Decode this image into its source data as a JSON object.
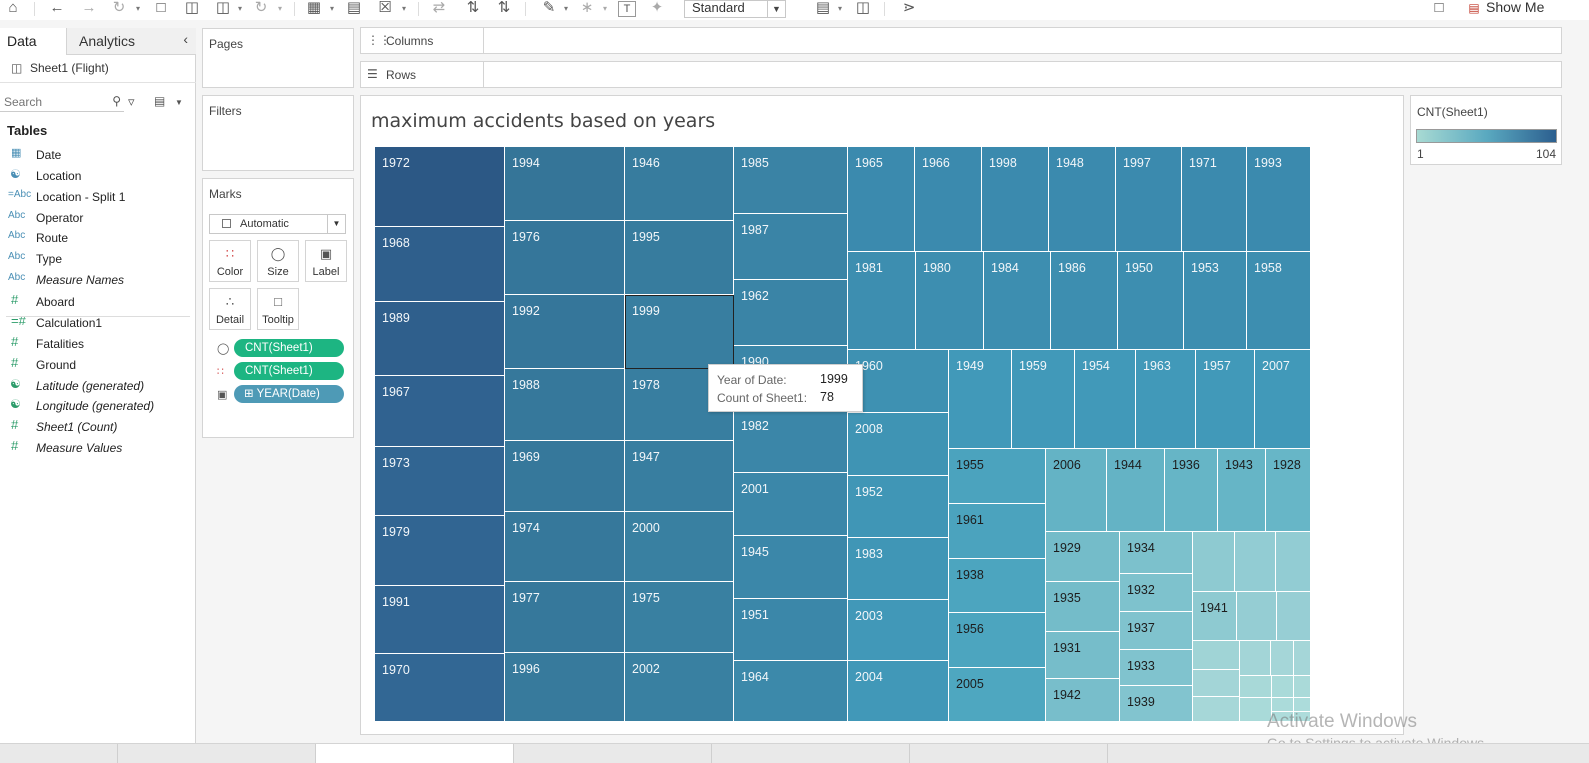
{
  "toolbar": {
    "fit_select": "Standard",
    "show_me": "Show Me"
  },
  "data_pane": {
    "tabs": {
      "data": "Data",
      "analytics": "Analytics"
    },
    "datasource": "Sheet1 (Flight)",
    "search_placeholder": "Search",
    "tables_heading": "Tables",
    "fields": [
      {
        "type": "date",
        "icon": "calendar-icon",
        "name": "Date"
      },
      {
        "type": "geo-dim",
        "icon": "globe-icon",
        "name": "Location"
      },
      {
        "type": "calc-dim",
        "icon": "abc-icon",
        "name": "Location - Split 1"
      },
      {
        "type": "dim",
        "icon": "abc-icon",
        "name": "Operator"
      },
      {
        "type": "dim",
        "icon": "abc-icon",
        "name": "Route"
      },
      {
        "type": "dim",
        "icon": "abc-icon",
        "name": "Type"
      },
      {
        "type": "dim-italic",
        "icon": "abc-icon",
        "name": "Measure Names"
      },
      {
        "type": "measure",
        "icon": "hash-icon",
        "name": "Aboard"
      },
      {
        "type": "calc-measure",
        "icon": "hash-icon",
        "name": "Calculation1"
      },
      {
        "type": "measure",
        "icon": "hash-icon",
        "name": "Fatalities"
      },
      {
        "type": "measure",
        "icon": "hash-icon",
        "name": "Ground"
      },
      {
        "type": "geo-italic",
        "icon": "globe-icon",
        "name": "Latitude (generated)"
      },
      {
        "type": "geo-italic",
        "icon": "globe-icon",
        "name": "Longitude (generated)"
      },
      {
        "type": "measure-italic",
        "icon": "hash-icon",
        "name": "Sheet1 (Count)"
      },
      {
        "type": "measure-italic",
        "icon": "hash-icon",
        "name": "Measure Values"
      }
    ]
  },
  "cards": {
    "pages": "Pages",
    "filters": "Filters",
    "marks": "Marks",
    "mark_type": "Automatic",
    "mark_buttons": {
      "color": "Color",
      "size": "Size",
      "label": "Label",
      "detail": "Detail",
      "tooltip": "Tooltip"
    },
    "pills": [
      {
        "icon": "size-icon",
        "label": "CNT(Sheet1)",
        "style": "green"
      },
      {
        "icon": "color-icon",
        "label": "CNT(Sheet1)",
        "style": "green"
      },
      {
        "icon": "label-icon",
        "label": "YEAR(Date)",
        "style": "blue"
      }
    ]
  },
  "shelves": {
    "columns": "Columns",
    "rows": "Rows"
  },
  "viz": {
    "title": "maximum accidents based on years"
  },
  "tooltip": {
    "year_key": "Year of Date:",
    "year_value": "1999",
    "count_key": "Count of Sheet1:",
    "count_value": "78"
  },
  "legend": {
    "title": "CNT(Sheet1)",
    "min": "1",
    "max": "104"
  },
  "watermark": {
    "line1": "Activate Windows",
    "line2": "Go to Settings to activate Windows."
  },
  "chart_data": {
    "type": "heatmap",
    "title": "maximum accidents based on years",
    "color_measure": "CNT(Sheet1)",
    "color_range": [
      1,
      104
    ],
    "color_low": "#a8dad3",
    "color_high": "#2c5f8f",
    "selected_label": "1999",
    "labels": [
      "1972",
      "1968",
      "1989",
      "1967",
      "1973",
      "1979",
      "1991",
      "1970",
      "1994",
      "1976",
      "1992",
      "1988",
      "1969",
      "1974",
      "1977",
      "1996",
      "1946",
      "1995",
      "1999",
      "1978",
      "1947",
      "2000",
      "1975",
      "2002",
      "1985",
      "1987",
      "1962",
      "1990",
      "1982",
      "2001",
      "1945",
      "1951",
      "1964",
      "1965",
      "1966",
      "1998",
      "1948",
      "1997",
      "1971",
      "1993",
      "1981",
      "1980",
      "1984",
      "1986",
      "1950",
      "1953",
      "1958",
      "1960",
      "2008",
      "1952",
      "1983",
      "2003",
      "2004",
      "1949",
      "1959",
      "1954",
      "1963",
      "1957",
      "2007",
      "1955",
      "1961",
      "1938",
      "1956",
      "2005",
      "2006",
      "1944",
      "1936",
      "1943",
      "1928",
      "1929",
      "1935",
      "1931",
      "1942",
      "1934",
      "1932",
      "1937",
      "1933",
      "1939",
      "1941"
    ]
  }
}
